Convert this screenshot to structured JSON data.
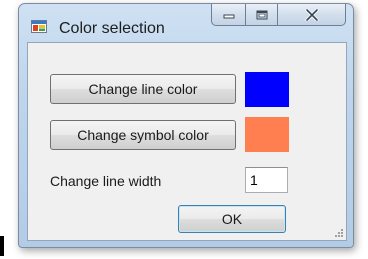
{
  "window": {
    "title": "Color selection",
    "icon": "app-window-icon",
    "caption_buttons": [
      "minimize-icon",
      "maximize-icon",
      "close-icon"
    ]
  },
  "form": {
    "change_line_color_label": "Change line color",
    "line_color": "#0000ff",
    "change_symbol_color_label": "Change symbol color",
    "symbol_color": "#ff7f50",
    "line_width_label": "Change line width",
    "line_width_value": "1",
    "ok_label": "OK"
  }
}
